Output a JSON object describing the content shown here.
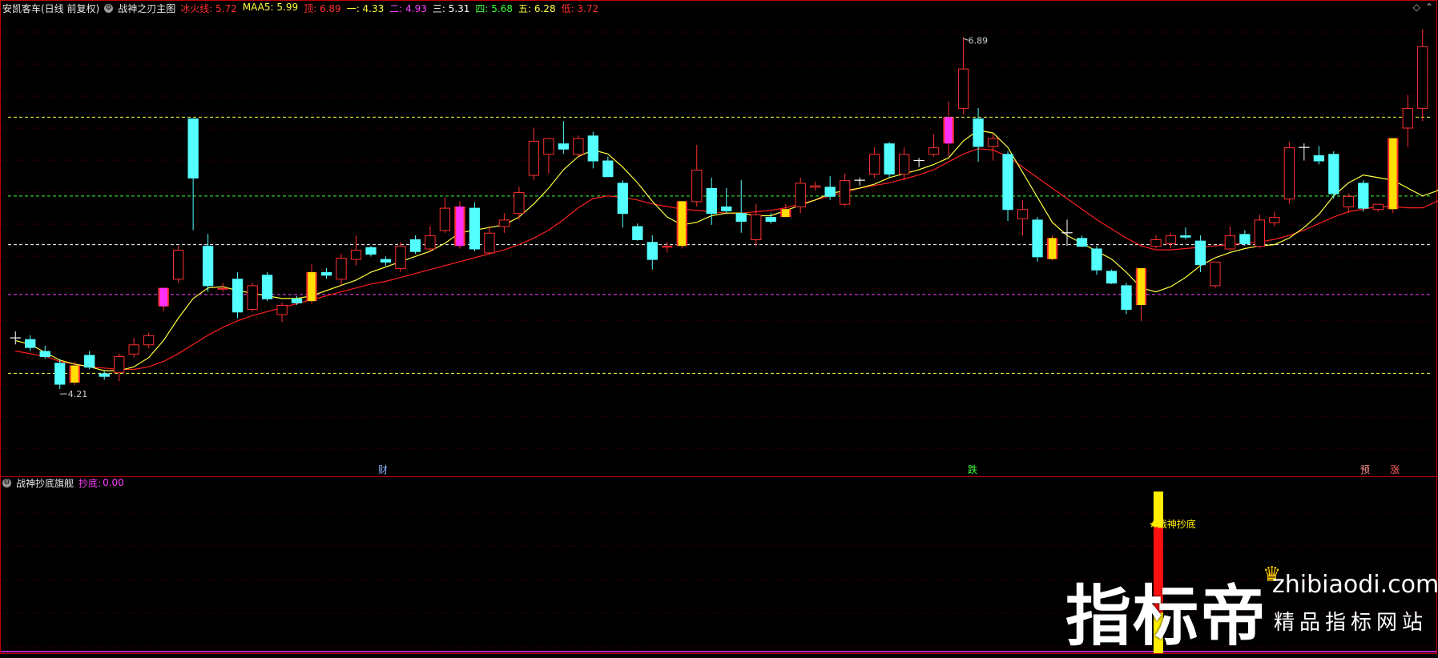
{
  "main_header": {
    "stock": "安凯客车(日线 前复权)",
    "indicator": "战神之刃主图",
    "items": [
      {
        "label": "冰火线:",
        "value": "5.72",
        "color": "#ff3030"
      },
      {
        "label": "MAA5:",
        "value": "5.99",
        "color": "#ffff40"
      },
      {
        "label": "顶:",
        "value": "6.89",
        "color": "#ff3030"
      },
      {
        "label": "一:",
        "value": "4.33",
        "color": "#ffff40"
      },
      {
        "label": "二:",
        "value": "4.93",
        "color": "#ff40ff"
      },
      {
        "label": "三:",
        "value": "5.31",
        "color": "#ffffff"
      },
      {
        "label": "四:",
        "value": "5.68",
        "color": "#40ff40"
      },
      {
        "label": "五:",
        "value": "6.28",
        "color": "#ffff40"
      },
      {
        "label": "低:",
        "value": "3.72",
        "color": "#ff3030"
      }
    ]
  },
  "sub_header": {
    "indicator": "战神抄底旗舰",
    "label": "抄底:",
    "value": "0.00"
  },
  "annotations": {
    "high_label": "6.89",
    "low_label": "4.21",
    "cai": "财",
    "die": "跌",
    "yu": "预",
    "zhang": "涨",
    "signal": "★战神抄底"
  },
  "watermark": {
    "big": "指标帝",
    "url": "zhibiaodi.com",
    "sub": "精品指标网站"
  },
  "colors": {
    "up": "#ff3030",
    "down": "#54ffff",
    "yellow": "#ffe000",
    "magenta": "#ff30ff",
    "ma_yellow": "#ffff40",
    "ma_red": "#ff2020",
    "border": "#c00000"
  },
  "chart_data": {
    "type": "candlestick",
    "ylim": [
      3.65,
      7.05
    ],
    "reference_lines": [
      {
        "name": "五",
        "value": 6.28,
        "color": "#ffff40"
      },
      {
        "name": "四",
        "value": 5.68,
        "color": "#40ff40"
      },
      {
        "name": "三",
        "value": 5.31,
        "color": "#ffffff"
      },
      {
        "name": "二",
        "value": 4.93,
        "color": "#ff40ff"
      },
      {
        "name": "一",
        "value": 4.33,
        "color": "#ffff40"
      }
    ],
    "candles": [
      {
        "o": 4.6,
        "h": 4.65,
        "l": 4.55,
        "c": 4.6,
        "t": "doji"
      },
      {
        "o": 4.59,
        "h": 4.62,
        "l": 4.5,
        "c": 4.53,
        "t": "down"
      },
      {
        "o": 4.5,
        "h": 4.54,
        "l": 4.44,
        "c": 4.46,
        "t": "down"
      },
      {
        "o": 4.41,
        "h": 4.44,
        "l": 4.21,
        "c": 4.25,
        "t": "down"
      },
      {
        "o": 4.26,
        "h": 4.42,
        "l": 4.24,
        "c": 4.39,
        "t": "yellow"
      },
      {
        "o": 4.47,
        "h": 4.5,
        "l": 4.36,
        "c": 4.38,
        "t": "down"
      },
      {
        "o": 4.33,
        "h": 4.35,
        "l": 4.28,
        "c": 4.31,
        "t": "down"
      },
      {
        "o": 4.34,
        "h": 4.48,
        "l": 4.27,
        "c": 4.46,
        "t": "up"
      },
      {
        "o": 4.48,
        "h": 4.6,
        "l": 4.45,
        "c": 4.55,
        "t": "up"
      },
      {
        "o": 4.55,
        "h": 4.64,
        "l": 4.52,
        "c": 4.62,
        "t": "up"
      },
      {
        "o": 4.84,
        "h": 4.98,
        "l": 4.8,
        "c": 4.98,
        "t": "magenta"
      },
      {
        "o": 5.05,
        "h": 5.3,
        "l": 5.02,
        "c": 5.27,
        "t": "up"
      },
      {
        "o": 6.27,
        "h": 6.27,
        "l": 5.42,
        "c": 5.82,
        "t": "down"
      },
      {
        "o": 5.3,
        "h": 5.39,
        "l": 4.95,
        "c": 5.0,
        "t": "down"
      },
      {
        "o": 4.98,
        "h": 5.02,
        "l": 4.95,
        "c": 4.98,
        "t": "up"
      },
      {
        "o": 5.05,
        "h": 5.1,
        "l": 4.75,
        "c": 4.8,
        "t": "down"
      },
      {
        "o": 4.82,
        "h": 5.02,
        "l": 4.8,
        "c": 5.0,
        "t": "up"
      },
      {
        "o": 5.08,
        "h": 5.1,
        "l": 4.88,
        "c": 4.9,
        "t": "down"
      },
      {
        "o": 4.78,
        "h": 4.87,
        "l": 4.72,
        "c": 4.85,
        "t": "up"
      },
      {
        "o": 4.9,
        "h": 4.92,
        "l": 4.85,
        "c": 4.87,
        "t": "down"
      },
      {
        "o": 4.88,
        "h": 5.16,
        "l": 4.86,
        "c": 5.1,
        "t": "yellow"
      },
      {
        "o": 5.1,
        "h": 5.13,
        "l": 5.05,
        "c": 5.08,
        "t": "down"
      },
      {
        "o": 5.05,
        "h": 5.24,
        "l": 5.0,
        "c": 5.21,
        "t": "up"
      },
      {
        "o": 5.2,
        "h": 5.38,
        "l": 5.15,
        "c": 5.27,
        "t": "up"
      },
      {
        "o": 5.29,
        "h": 5.3,
        "l": 5.22,
        "c": 5.24,
        "t": "down"
      },
      {
        "o": 5.2,
        "h": 5.22,
        "l": 5.15,
        "c": 5.18,
        "t": "down"
      },
      {
        "o": 5.13,
        "h": 5.33,
        "l": 5.1,
        "c": 5.3,
        "t": "up"
      },
      {
        "o": 5.35,
        "h": 5.38,
        "l": 5.24,
        "c": 5.26,
        "t": "down"
      },
      {
        "o": 5.28,
        "h": 5.45,
        "l": 5.25,
        "c": 5.38,
        "t": "up"
      },
      {
        "o": 5.42,
        "h": 5.67,
        "l": 5.4,
        "c": 5.59,
        "t": "up"
      },
      {
        "o": 5.3,
        "h": 5.64,
        "l": 5.28,
        "c": 5.6,
        "t": "magenta"
      },
      {
        "o": 5.59,
        "h": 5.63,
        "l": 5.26,
        "c": 5.28,
        "t": "down"
      },
      {
        "o": 5.25,
        "h": 5.45,
        "l": 5.24,
        "c": 5.4,
        "t": "up"
      },
      {
        "o": 5.45,
        "h": 5.55,
        "l": 5.4,
        "c": 5.5,
        "t": "up"
      },
      {
        "o": 5.55,
        "h": 5.75,
        "l": 5.5,
        "c": 5.71,
        "t": "up"
      },
      {
        "o": 5.84,
        "h": 6.2,
        "l": 5.8,
        "c": 6.1,
        "t": "up"
      },
      {
        "o": 6.0,
        "h": 6.12,
        "l": 5.85,
        "c": 6.12,
        "t": "up"
      },
      {
        "o": 6.04,
        "h": 6.25,
        "l": 6.0,
        "c": 6.08,
        "t": "down"
      },
      {
        "o": 6.0,
        "h": 6.14,
        "l": 5.98,
        "c": 6.12,
        "t": "up"
      },
      {
        "o": 6.14,
        "h": 6.17,
        "l": 5.89,
        "c": 5.95,
        "t": "down"
      },
      {
        "o": 5.95,
        "h": 5.98,
        "l": 5.83,
        "c": 5.83,
        "t": "down"
      },
      {
        "o": 5.78,
        "h": 5.8,
        "l": 5.44,
        "c": 5.55,
        "t": "down"
      },
      {
        "o": 5.45,
        "h": 5.47,
        "l": 5.34,
        "c": 5.35,
        "t": "down"
      },
      {
        "o": 5.33,
        "h": 5.38,
        "l": 5.12,
        "c": 5.2,
        "t": "down"
      },
      {
        "o": 5.3,
        "h": 5.33,
        "l": 5.25,
        "c": 5.3,
        "t": "up"
      },
      {
        "o": 5.3,
        "h": 5.64,
        "l": 5.28,
        "c": 5.64,
        "t": "yellow"
      },
      {
        "o": 5.64,
        "h": 6.07,
        "l": 5.6,
        "c": 5.88,
        "t": "up"
      },
      {
        "o": 5.74,
        "h": 5.82,
        "l": 5.46,
        "c": 5.55,
        "t": "down"
      },
      {
        "o": 5.6,
        "h": 5.74,
        "l": 5.55,
        "c": 5.57,
        "t": "down"
      },
      {
        "o": 5.55,
        "h": 5.8,
        "l": 5.4,
        "c": 5.49,
        "t": "down"
      },
      {
        "o": 5.35,
        "h": 5.62,
        "l": 5.3,
        "c": 5.54,
        "t": "up"
      },
      {
        "o": 5.52,
        "h": 5.55,
        "l": 5.47,
        "c": 5.49,
        "t": "down"
      },
      {
        "o": 5.58,
        "h": 5.62,
        "l": 5.52,
        "c": 5.52,
        "t": "yellow"
      },
      {
        "o": 5.6,
        "h": 5.82,
        "l": 5.55,
        "c": 5.78,
        "t": "up"
      },
      {
        "o": 5.75,
        "h": 5.79,
        "l": 5.72,
        "c": 5.76,
        "t": "up"
      },
      {
        "o": 5.75,
        "h": 5.83,
        "l": 5.65,
        "c": 5.68,
        "t": "down"
      },
      {
        "o": 5.62,
        "h": 5.85,
        "l": 5.6,
        "c": 5.8,
        "t": "up"
      },
      {
        "o": 5.8,
        "h": 5.82,
        "l": 5.76,
        "c": 5.8,
        "t": "doji"
      },
      {
        "o": 5.85,
        "h": 6.05,
        "l": 5.82,
        "c": 6.0,
        "t": "up"
      },
      {
        "o": 6.08,
        "h": 6.09,
        "l": 5.82,
        "c": 5.85,
        "t": "down"
      },
      {
        "o": 5.85,
        "h": 6.05,
        "l": 5.8,
        "c": 6.0,
        "t": "up"
      },
      {
        "o": 5.95,
        "h": 5.97,
        "l": 5.9,
        "c": 5.95,
        "t": "doji"
      },
      {
        "o": 6.0,
        "h": 6.15,
        "l": 5.98,
        "c": 6.05,
        "t": "up"
      },
      {
        "o": 6.08,
        "h": 6.4,
        "l": 5.98,
        "c": 6.28,
        "t": "magenta"
      },
      {
        "o": 6.35,
        "h": 6.89,
        "l": 6.3,
        "c": 6.65,
        "t": "up"
      },
      {
        "o": 6.27,
        "h": 6.35,
        "l": 5.94,
        "c": 6.06,
        "t": "down"
      },
      {
        "o": 6.06,
        "h": 6.15,
        "l": 5.95,
        "c": 6.12,
        "t": "up"
      },
      {
        "o": 6.0,
        "h": 6.02,
        "l": 5.49,
        "c": 5.58,
        "t": "down"
      },
      {
        "o": 5.51,
        "h": 5.65,
        "l": 5.38,
        "c": 5.58,
        "t": "up"
      },
      {
        "o": 5.5,
        "h": 5.52,
        "l": 5.18,
        "c": 5.22,
        "t": "down"
      },
      {
        "o": 5.2,
        "h": 5.38,
        "l": 5.19,
        "c": 5.36,
        "t": "yellow"
      },
      {
        "o": 5.4,
        "h": 5.5,
        "l": 5.3,
        "c": 5.39,
        "t": "doji"
      },
      {
        "o": 5.36,
        "h": 5.38,
        "l": 5.29,
        "c": 5.3,
        "t": "down"
      },
      {
        "o": 5.28,
        "h": 5.3,
        "l": 5.08,
        "c": 5.12,
        "t": "down"
      },
      {
        "o": 5.11,
        "h": 5.12,
        "l": 5.01,
        "c": 5.02,
        "t": "down"
      },
      {
        "o": 5.0,
        "h": 5.02,
        "l": 4.78,
        "c": 4.82,
        "t": "down"
      },
      {
        "o": 4.85,
        "h": 5.13,
        "l": 4.73,
        "c": 5.13,
        "t": "yellow"
      },
      {
        "o": 5.3,
        "h": 5.38,
        "l": 5.28,
        "c": 5.35,
        "t": "up"
      },
      {
        "o": 5.32,
        "h": 5.4,
        "l": 5.28,
        "c": 5.38,
        "t": "up"
      },
      {
        "o": 5.38,
        "h": 5.44,
        "l": 5.35,
        "c": 5.37,
        "t": "down"
      },
      {
        "o": 5.34,
        "h": 5.38,
        "l": 5.1,
        "c": 5.16,
        "t": "down"
      },
      {
        "o": 5.0,
        "h": 5.18,
        "l": 4.98,
        "c": 5.18,
        "t": "up"
      },
      {
        "o": 5.28,
        "h": 5.45,
        "l": 5.26,
        "c": 5.38,
        "t": "up"
      },
      {
        "o": 5.39,
        "h": 5.42,
        "l": 5.3,
        "c": 5.32,
        "t": "down"
      },
      {
        "o": 5.3,
        "h": 5.54,
        "l": 5.28,
        "c": 5.5,
        "t": "up"
      },
      {
        "o": 5.48,
        "h": 5.56,
        "l": 5.45,
        "c": 5.52,
        "t": "up"
      },
      {
        "o": 5.66,
        "h": 6.09,
        "l": 5.62,
        "c": 6.05,
        "t": "up"
      },
      {
        "o": 6.05,
        "h": 6.08,
        "l": 5.95,
        "c": 6.0,
        "t": "doji"
      },
      {
        "o": 5.99,
        "h": 6.06,
        "l": 5.92,
        "c": 5.95,
        "t": "down"
      },
      {
        "o": 6.0,
        "h": 6.02,
        "l": 5.66,
        "c": 5.7,
        "t": "down"
      },
      {
        "o": 5.6,
        "h": 5.7,
        "l": 5.55,
        "c": 5.68,
        "t": "up"
      },
      {
        "o": 5.78,
        "h": 5.8,
        "l": 5.56,
        "c": 5.59,
        "t": "down"
      },
      {
        "o": 5.58,
        "h": 5.62,
        "l": 5.56,
        "c": 5.62,
        "t": "up"
      },
      {
        "o": 5.58,
        "h": 6.12,
        "l": 5.55,
        "c": 6.12,
        "t": "yellow"
      },
      {
        "o": 6.2,
        "h": 6.45,
        "l": 6.05,
        "c": 6.35,
        "t": "up"
      },
      {
        "o": 6.35,
        "h": 6.95,
        "l": 6.25,
        "c": 6.82,
        "t": "up"
      }
    ],
    "ma_yellow": [
      4.58,
      4.55,
      4.49,
      4.43,
      4.4,
      4.38,
      4.35,
      4.35,
      4.38,
      4.45,
      4.58,
      4.75,
      4.9,
      4.98,
      4.99,
      4.96,
      4.94,
      4.92,
      4.9,
      4.9,
      4.92,
      4.96,
      5.0,
      5.04,
      5.1,
      5.14,
      5.18,
      5.22,
      5.26,
      5.32,
      5.4,
      5.42,
      5.44,
      5.46,
      5.52,
      5.62,
      5.74,
      5.88,
      5.98,
      6.03,
      6.0,
      5.9,
      5.78,
      5.64,
      5.52,
      5.46,
      5.48,
      5.53,
      5.55,
      5.55,
      5.53,
      5.53,
      5.57,
      5.61,
      5.65,
      5.7,
      5.72,
      5.74,
      5.77,
      5.82,
      5.85,
      5.88,
      5.92,
      5.97,
      6.1,
      6.18,
      6.16,
      6.05,
      5.86,
      5.67,
      5.48,
      5.38,
      5.32,
      5.26,
      5.2,
      5.1,
      4.98,
      4.95,
      4.99,
      5.06,
      5.15,
      5.21,
      5.25,
      5.28,
      5.3,
      5.31,
      5.36,
      5.44,
      5.54,
      5.68,
      5.78,
      5.84,
      5.82,
      5.8,
      5.74,
      5.68,
      5.72,
      5.86,
      6.02
    ],
    "ma_red": [
      4.5,
      4.48,
      4.46,
      4.42,
      4.4,
      4.38,
      4.37,
      4.36,
      4.36,
      4.38,
      4.42,
      4.48,
      4.55,
      4.62,
      4.68,
      4.73,
      4.77,
      4.8,
      4.83,
      4.86,
      4.89,
      4.92,
      4.95,
      4.98,
      5.01,
      5.03,
      5.06,
      5.09,
      5.12,
      5.15,
      5.18,
      5.21,
      5.24,
      5.27,
      5.31,
      5.36,
      5.42,
      5.5,
      5.59,
      5.66,
      5.68,
      5.67,
      5.65,
      5.62,
      5.6,
      5.58,
      5.57,
      5.56,
      5.55,
      5.55,
      5.56,
      5.57,
      5.59,
      5.62,
      5.65,
      5.68,
      5.71,
      5.74,
      5.76,
      5.78,
      5.81,
      5.84,
      5.88,
      5.94,
      6.0,
      6.04,
      6.03,
      5.98,
      5.9,
      5.82,
      5.74,
      5.66,
      5.58,
      5.5,
      5.43,
      5.36,
      5.3,
      5.27,
      5.27,
      5.28,
      5.29,
      5.3,
      5.31,
      5.32,
      5.33,
      5.35,
      5.38,
      5.42,
      5.47,
      5.52,
      5.56,
      5.58,
      5.6,
      5.6,
      5.59,
      5.59,
      5.64,
      5.72,
      5.78
    ],
    "signal_bar": {
      "index": 77,
      "value": 1.0,
      "segments": [
        {
          "color": "#ffee00",
          "frac": 0.22
        },
        {
          "color": "#ff1010",
          "frac": 0.53
        },
        {
          "color": "#ffee00",
          "frac": 0.25
        }
      ]
    }
  }
}
